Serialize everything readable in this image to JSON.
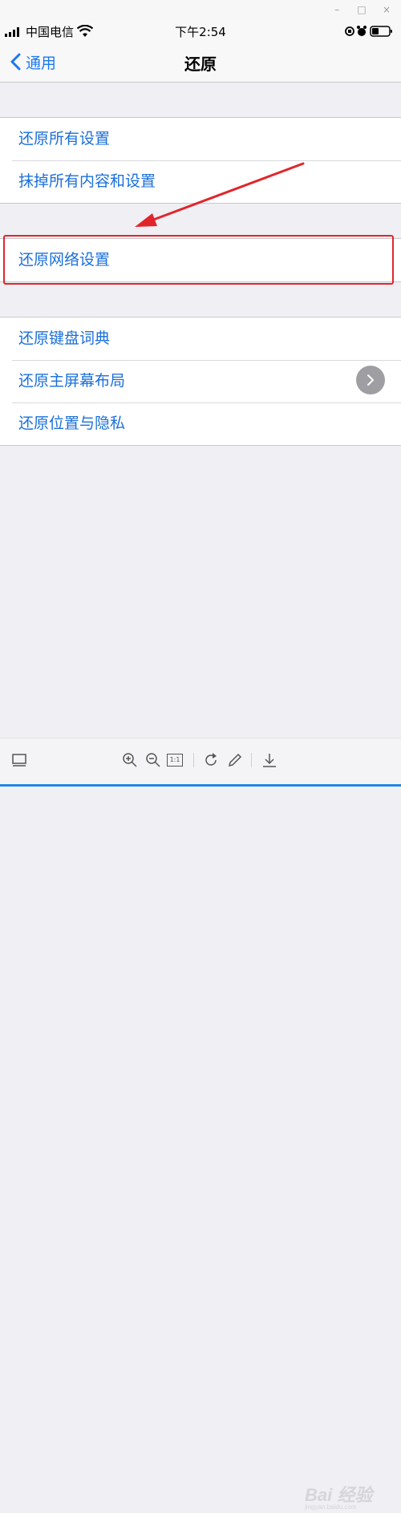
{
  "window": {
    "minimize_glyph": "–",
    "maximize_glyph": "□",
    "close_glyph": "×"
  },
  "status": {
    "carrier": "中国电信",
    "time": "下午2:54"
  },
  "nav": {
    "back_label": "通用",
    "title": "还原"
  },
  "groups": [
    {
      "items": [
        "还原所有设置",
        "抹掉所有内容和设置"
      ]
    },
    {
      "items": [
        "还原网络设置"
      ]
    },
    {
      "items": [
        "还原键盘词典",
        "还原主屏幕布局",
        "还原位置与隐私"
      ]
    }
  ],
  "toolbar": {
    "actual_size_label": "1:1"
  },
  "watermark": {
    "text": "Bai 经验",
    "sub": "jingyan.baidu.com"
  },
  "colors": {
    "link_blue": "#1a6fdc",
    "highlight_red": "#e0262b",
    "background": "#efeff4"
  }
}
